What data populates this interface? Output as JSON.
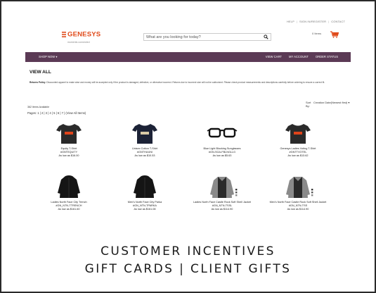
{
  "header": {
    "utility_links": [
      "HELP",
      "SIGN IN/REGISTER",
      "CONTACT"
    ],
    "logo_name": "GENESYS",
    "logo_tagline": "moments connected",
    "search_placeholder": "What are you looking for today?",
    "cart_count_label": "0 Items"
  },
  "nav": {
    "shop_label": "SHOP NOW",
    "links": [
      "VIEW CART",
      "MY ACCOUNT",
      "ORDER STATUS"
    ]
  },
  "page": {
    "title": "VIEW ALL",
    "policy_label": "Returns Policy:",
    "policy_text": "Discounted apparel to make wise and money will be accepted only if the product is damaged, defective, or otherwise incorrect. Returns due to incorrect size will not be authorized. Please check product measurements and descriptions carefully before ordering to ensure a correct fit.",
    "items_available": "362 Items Available",
    "pages": "Pages: 1 | 2 | 3 | 4 | 5 | 6 | 7 | (View All Items)",
    "sort_label": "Sort By:",
    "sort_value": "Creation Date(Newest first)"
  },
  "products": [
    {
      "name": "Equity T-Shirt",
      "sku": "#GNTEQUITY",
      "price": "As low as $16.00",
      "icon": "tshirt-icon",
      "color": "#2a2a2a",
      "accent": "#e0441b"
    },
    {
      "name": "Unisex Cotton T-Shirt",
      "sku": "#GNTHUUNI",
      "price": "As low as $10.53",
      "icon": "tshirt-icon",
      "color": "#1c2236",
      "accent": "#d9c9a6"
    },
    {
      "name": "Blue Light Blocking Sunglasses",
      "sku": "#GN-SGA-FBLNGLLG",
      "price": "As low as $5.63",
      "icon": "glasses-icon",
      "color": "#111111",
      "accent": "#111111"
    },
    {
      "name": "Genesys Ladies Voting T-Shirt",
      "sku": "#GNTTVOTEL",
      "price": "As low as $13.62",
      "icon": "tshirt-icon",
      "color": "#2a2a2a",
      "accent": "#e0441b"
    },
    {
      "name": "Ladies North Face City Trench",
      "sku": "#GN_NTN-TTRENCH",
      "price": "As low as $161.60",
      "icon": "jacket-icon",
      "color": "#151515",
      "accent": "#151515"
    },
    {
      "name": "Men's North Face City Parka",
      "sku": "#GN_NTN-TPARKA",
      "price": "As low as $161.08",
      "icon": "jacket-icon",
      "color": "#151515",
      "accent": "#151515"
    },
    {
      "name": "Ladies North Face Castle Rock Soft Shell Jacket",
      "sku": "#GN_NTN-TSSL",
      "price": "As low as $114.90",
      "icon": "softshell-icon",
      "color": "#8a8a8a",
      "accent": "#2a2a2a"
    },
    {
      "name": "Men's North Face Castle Rock Soft Shell Jacket",
      "sku": "#GN_NTN-TSS",
      "price": "As low as $114.90",
      "icon": "softshell-icon",
      "color": "#8a8a8a",
      "accent": "#2a2a2a"
    }
  ],
  "caption": {
    "line1": "CUSTOMER INCENTIVES",
    "line2": "GIFT CARDS | CLIENT GIFTS"
  },
  "colors": {
    "nav_bar": "#5b3a55",
    "brand": "#e04b1b"
  }
}
